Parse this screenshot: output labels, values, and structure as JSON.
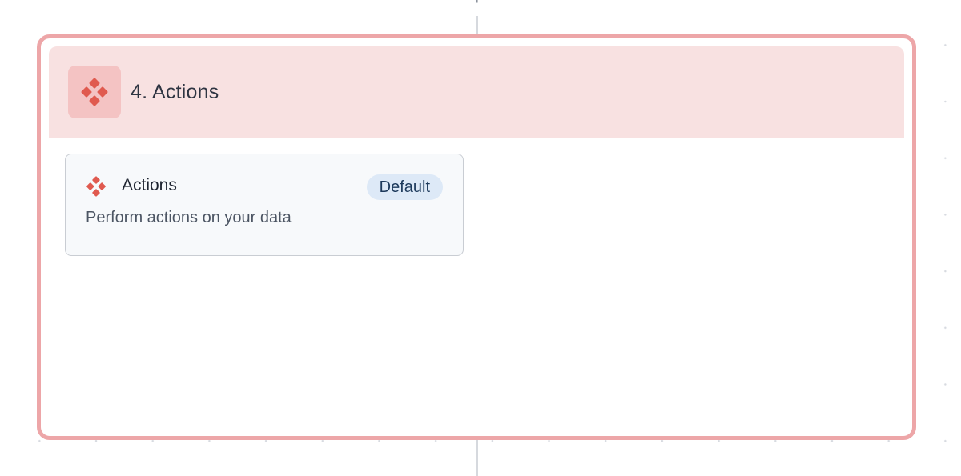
{
  "canvas": {
    "add_icon": "plus-icon"
  },
  "node": {
    "title": "4. Actions",
    "icon": "actions-diamond-icon",
    "accent_color": "#e05a4f",
    "border_color": "#eda6a8",
    "header_color": "#f8e1e1"
  },
  "option": {
    "title": "Actions",
    "description": "Perform actions on your data",
    "badge": "Default",
    "icon": "actions-diamond-icon"
  }
}
